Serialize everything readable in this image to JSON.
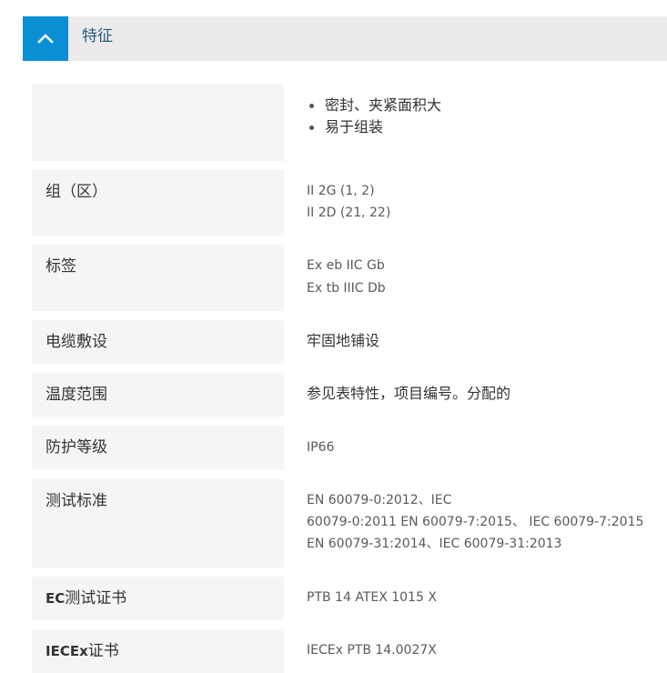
{
  "section": {
    "title": "特征",
    "toggle_icon": "chevron-up-icon",
    "accent_color": "#0a8fd4",
    "expanded": true
  },
  "features": {
    "bullets": [
      "密封、夹紧面积大",
      "易于组装"
    ]
  },
  "rows": [
    {
      "label": "组（区）",
      "values": [
        "II 2G (1, 2)",
        "II 2D (21, 22)"
      ]
    },
    {
      "label": "标签",
      "values": [
        "Ex eb IIC Gb",
        "Ex tb IIIC Db"
      ]
    },
    {
      "label": "电缆敷设",
      "values": [
        "牢固地铺设"
      ]
    },
    {
      "label": "温度范围",
      "values": [
        "参见表特性，项目编号。分配的"
      ]
    },
    {
      "label": "防护等级",
      "values": [
        "IP66"
      ]
    },
    {
      "label": "测试标准",
      "values": [
        "EN 60079-0:2012、IEC",
        "60079-0:2011 EN 60079-7:2015、 IEC 60079-7:2015",
        "EN 60079-31:2014、IEC 60079-31:2013"
      ]
    },
    {
      "label_prefix": "EC",
      "label": "测试证书",
      "values": [
        "PTB 14 ATEX 1015 X"
      ]
    },
    {
      "label_prefix": "IECEx",
      "label": "证书",
      "values": [
        "IECEx PTB 14.0027X"
      ]
    }
  ]
}
